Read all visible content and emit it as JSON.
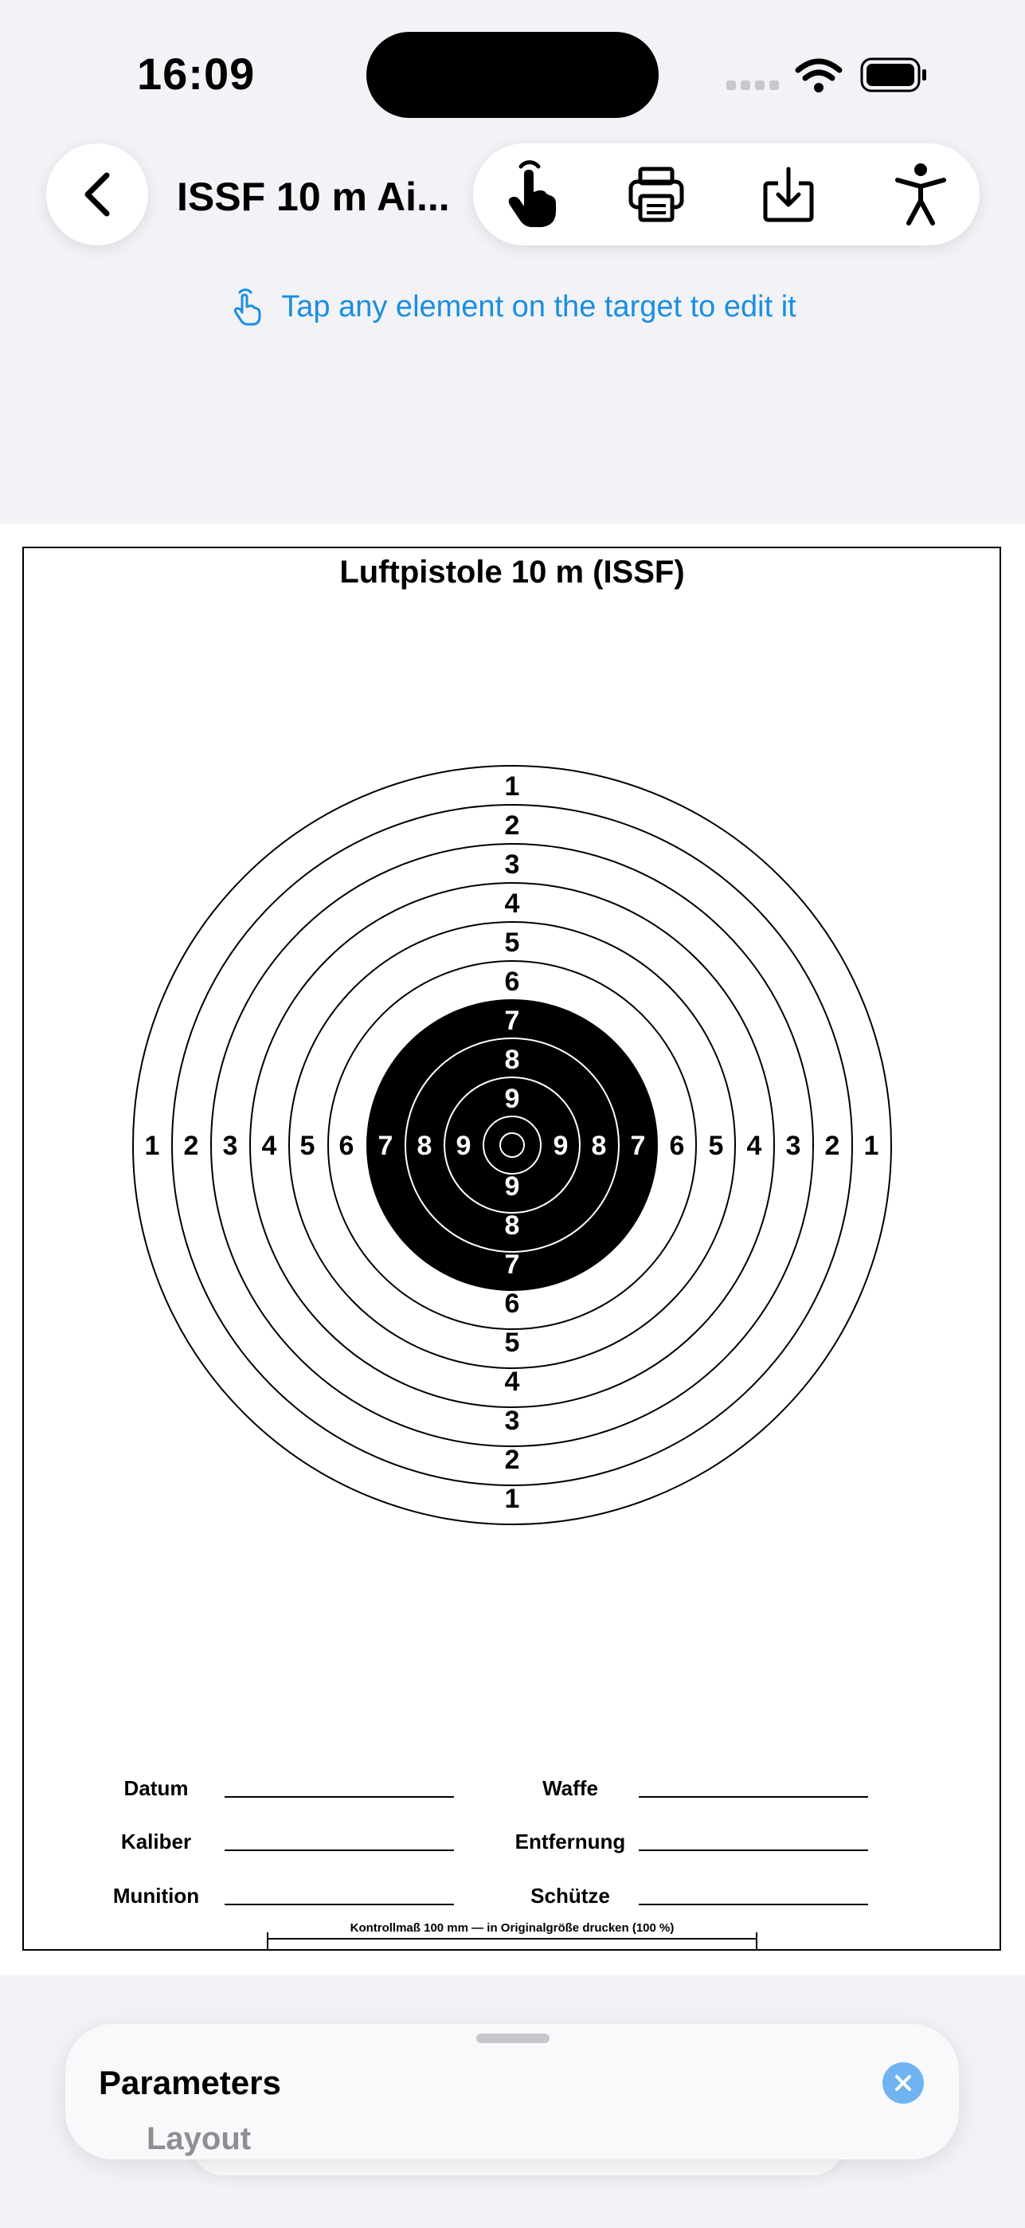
{
  "status": {
    "time": "16:09"
  },
  "nav": {
    "title": "ISSF 10 m Ai..."
  },
  "hint": {
    "text": "Tap any element on the target to edit it"
  },
  "target": {
    "title": "Luftpistole 10 m (ISSF)",
    "ring_numbers": [
      "1",
      "2",
      "3",
      "4",
      "5",
      "6",
      "7",
      "8",
      "9"
    ],
    "fields": {
      "datum": "Datum",
      "waffe": "Waffe",
      "kaliber": "Kaliber",
      "entfernung": "Entfernung",
      "munition": "Munition",
      "schuetze": "Schütze"
    },
    "scale_note": "Kontrollmaß 100 mm — in Originalgröße drucken (100 %)"
  },
  "params": {
    "title": "Parameters",
    "tab": "Layout"
  },
  "colors": {
    "accent": "#1a8fe0",
    "close": "#6fb4f0",
    "target_black": "#000000"
  }
}
